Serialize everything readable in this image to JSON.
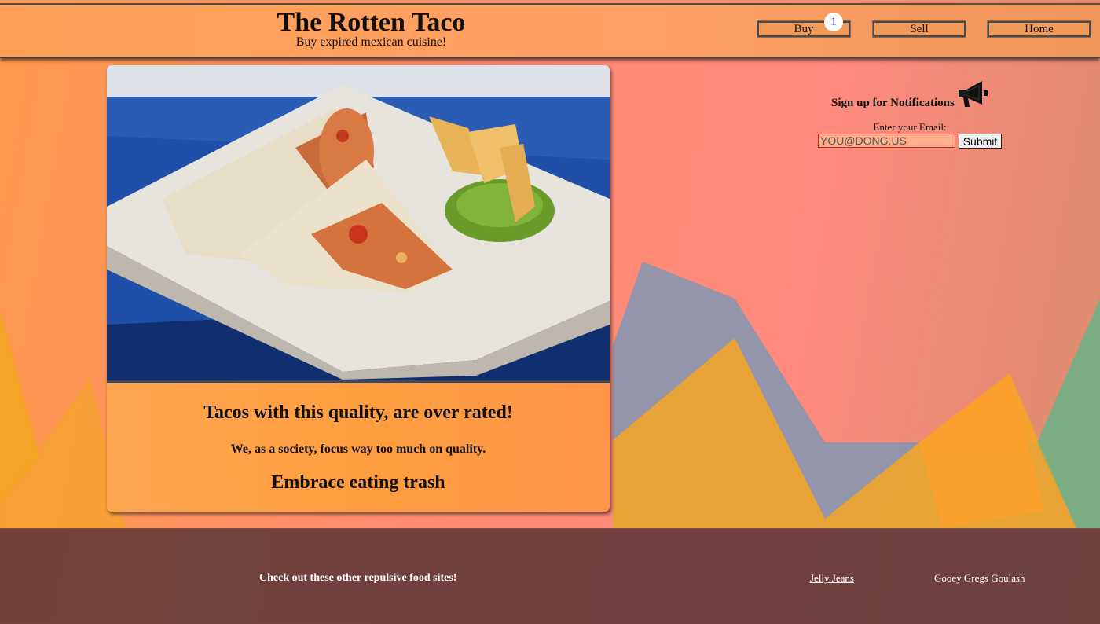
{
  "header": {
    "title": "The Rotten Taco",
    "tagline": "Buy expired mexican cuisine!",
    "nav": {
      "buy": "Buy",
      "sell": "Sell",
      "home": "Home"
    },
    "cart_count": "1"
  },
  "card": {
    "image_icon": "burrito-photo",
    "heading": "Tacos with this quality, are over rated!",
    "text": "We, as a society, focus way too much on quality.",
    "subheading": "Embrace eating trash"
  },
  "notifications": {
    "title": "Sign up for Notifications",
    "icon": "megaphone-icon",
    "email_label": "Enter your Email:",
    "email_value": "YOU@DONG.US",
    "submit_label": "Submit"
  },
  "footer": {
    "cta": "Check out these other repulsive food sites!",
    "links": [
      "Jelly Jeans",
      "Gooey Gregs Goulash"
    ]
  },
  "colors": {
    "background": "#ff8a72",
    "header": "#ff9f66",
    "footer": "#5f3737",
    "card_body": "#ffa14a"
  }
}
